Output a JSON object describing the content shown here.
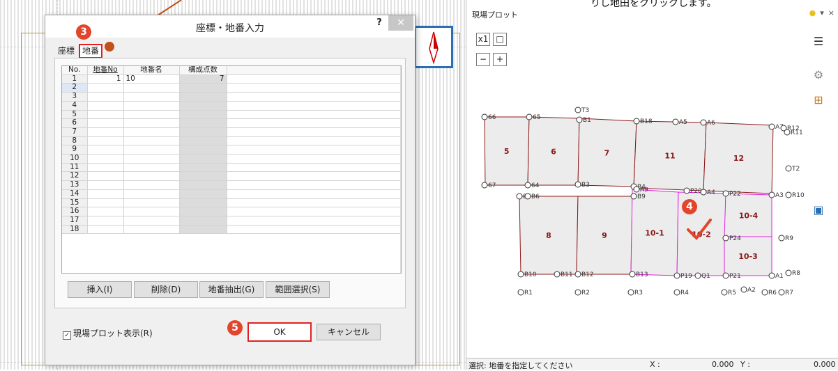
{
  "dialog": {
    "title": "座標・地番入力",
    "help": "?",
    "close": "✕",
    "tabs": [
      "座標",
      "地番"
    ],
    "grid": {
      "headers": [
        "No.",
        "地番No",
        "地番名",
        "構成点数"
      ],
      "rows": [
        [
          "1",
          "1",
          "10",
          "7"
        ],
        [
          "2",
          "",
          "",
          ""
        ],
        [
          "3",
          "",
          "",
          ""
        ],
        [
          "4",
          "",
          "",
          ""
        ],
        [
          "5",
          "",
          "",
          ""
        ],
        [
          "6",
          "",
          "",
          ""
        ],
        [
          "7",
          "",
          "",
          ""
        ],
        [
          "8",
          "",
          "",
          ""
        ],
        [
          "9",
          "",
          "",
          ""
        ],
        [
          "10",
          "",
          "",
          ""
        ],
        [
          "11",
          "",
          "",
          ""
        ],
        [
          "12",
          "",
          "",
          ""
        ],
        [
          "13",
          "",
          "",
          ""
        ],
        [
          "14",
          "",
          "",
          ""
        ],
        [
          "15",
          "",
          "",
          ""
        ],
        [
          "16",
          "",
          "",
          ""
        ],
        [
          "17",
          "",
          "",
          ""
        ],
        [
          "18",
          "",
          "",
          ""
        ]
      ]
    },
    "buttons": {
      "insert": "挿入(I)",
      "delete": "削除(D)",
      "extract": "地番抽出(G)",
      "range": "範囲選択(S)",
      "ok": "OK",
      "cancel": "キャンセル"
    },
    "checkbox_label": "現場プロット表示(R)",
    "checkbox_checked": true
  },
  "markers": {
    "step3": "3",
    "step4": "4",
    "step5": "5"
  },
  "right_panel": {
    "title": "現場プロット",
    "top_caption": "りし地田をクリックします。",
    "tools": [
      "x1",
      "□",
      "−",
      "+"
    ],
    "side_icons": [
      "menu-icon",
      "gear-icon",
      "layout-icon",
      "photo-icon"
    ],
    "parcels": [
      {
        "label": "5"
      },
      {
        "label": "6"
      },
      {
        "label": "7"
      },
      {
        "label": "11"
      },
      {
        "label": "12"
      },
      {
        "label": "8"
      },
      {
        "label": "9"
      },
      {
        "label": "10-1"
      },
      {
        "label": "10-2"
      },
      {
        "label": "10-4"
      },
      {
        "label": "10-3"
      }
    ],
    "points": [
      "T3",
      "66",
      "65",
      "B1",
      "B18",
      "A5",
      "A6",
      "A7",
      "R12",
      "R11",
      "T2",
      "67",
      "64",
      "B3",
      "B4",
      "A9",
      "P20",
      "A4",
      "P22",
      "A3",
      "R10",
      "B5",
      "B6",
      "B9",
      "P24",
      "R9",
      "B10",
      "B11",
      "B12",
      "B13",
      "P19",
      "Q1",
      "P21",
      "A1",
      "R8",
      "R1",
      "R2",
      "R3",
      "R4",
      "R5",
      "A2",
      "R6",
      "R7"
    ],
    "status": {
      "message": "選択: 地番を指定してください",
      "x_label": "X :",
      "x_value": "0.000",
      "y_label": "Y :",
      "y_value": "0.000"
    }
  },
  "colors": {
    "accent_red": "#e02020",
    "marker": "#e2452b",
    "parcel_line": "#8b1a1a",
    "selection": "#e020e0"
  }
}
